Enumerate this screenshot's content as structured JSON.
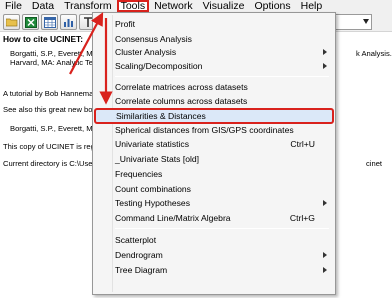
{
  "menubar": {
    "items": [
      "File",
      "Data",
      "Transform",
      "Tools",
      "Network",
      "Visualize",
      "Options",
      "Help"
    ]
  },
  "toolbar": {
    "buttons": [
      "folder-open-icon",
      "excel-icon",
      "matrix-editor-icon",
      "chart-icon",
      "text-icon"
    ]
  },
  "document": {
    "heading": "How to cite UCINET:",
    "cite_line1": "Borgatti, S.P., Everett, M.G",
    "cite_line1_tail": "k Analysis.",
    "cite_line2": "Harvard, MA: Analytic Tec",
    "tutorial": "A tutorial by Bob Hanneman",
    "see_also": "See also this great new book",
    "cite_book": "Borgatti, S.P., Everett, M.G",
    "copy": "This copy of UCINET is regis",
    "current_dir": "Current directory is C:\\Users\\",
    "current_dir_tail": "cinet"
  },
  "tools_menu": {
    "items": [
      {
        "label": "Profit",
        "shortcut": "",
        "submenu": false
      },
      {
        "label": "Consensus Analysis",
        "shortcut": "",
        "submenu": false
      },
      {
        "label": "Cluster Analysis",
        "shortcut": "",
        "submenu": true
      },
      {
        "label": "Scaling/Decomposition",
        "shortcut": "",
        "submenu": true
      },
      {
        "label": "Correlate matrices across datasets",
        "shortcut": "",
        "submenu": false
      },
      {
        "label": "Correlate columns across datasets",
        "shortcut": "",
        "submenu": false
      },
      {
        "label": "Similarities & Distances",
        "shortcut": "",
        "submenu": false
      },
      {
        "label": "Spherical distances from GIS/GPS coordinates",
        "shortcut": "",
        "submenu": false
      },
      {
        "label": "Univariate statistics",
        "shortcut": "Ctrl+U",
        "submenu": false
      },
      {
        "label": "_Univariate Stats [old]",
        "shortcut": "",
        "submenu": false
      },
      {
        "label": "Frequencies",
        "shortcut": "",
        "submenu": false
      },
      {
        "label": "Count combinations",
        "shortcut": "",
        "submenu": false
      },
      {
        "label": "Testing Hypotheses",
        "shortcut": "",
        "submenu": true
      },
      {
        "label": "Command Line/Matrix Algebra",
        "shortcut": "Ctrl+G",
        "submenu": false
      },
      {
        "label": "Scatterplot",
        "shortcut": "",
        "submenu": false
      },
      {
        "label": "Dendrogram",
        "shortcut": "",
        "submenu": true
      },
      {
        "label": "Tree Diagram",
        "shortcut": "",
        "submenu": true
      }
    ]
  },
  "colors": {
    "annotation_red": "#d9221d",
    "highlight": "#dbe8f8"
  }
}
